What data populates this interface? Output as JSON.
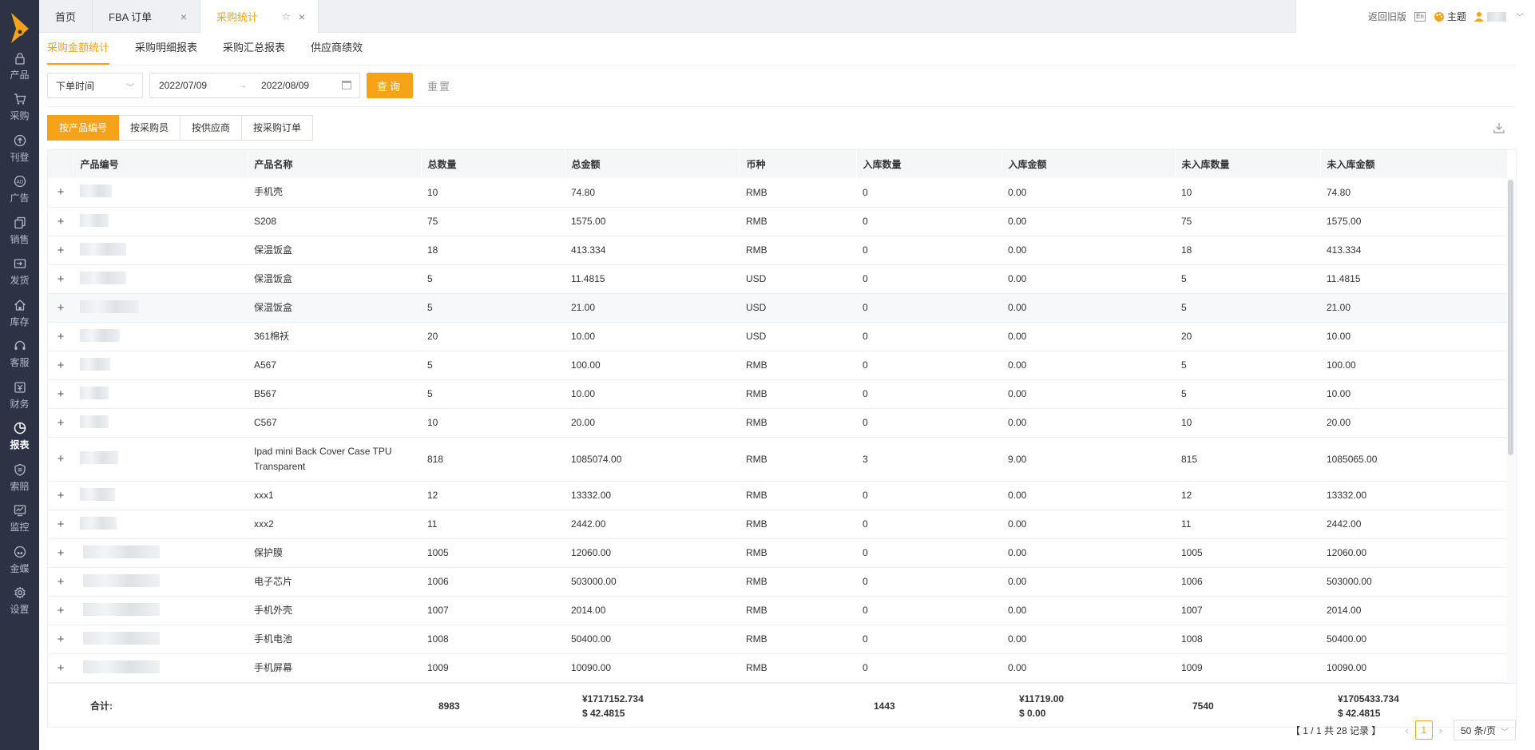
{
  "sidebar": {
    "items": [
      {
        "label": "产品",
        "icon": "lock-icon"
      },
      {
        "label": "采购",
        "icon": "cart-icon"
      },
      {
        "label": "刊登",
        "icon": "upload-icon"
      },
      {
        "label": "广告",
        "icon": "ad-icon"
      },
      {
        "label": "销售",
        "icon": "copy-icon"
      },
      {
        "label": "发货",
        "icon": "truck-icon"
      },
      {
        "label": "库存",
        "icon": "home-icon"
      },
      {
        "label": "客服",
        "icon": "headset-icon"
      },
      {
        "label": "财务",
        "icon": "wallet-icon"
      },
      {
        "label": "报表",
        "icon": "pie-chart-icon"
      },
      {
        "label": "索赔",
        "icon": "shield-icon"
      },
      {
        "label": "监控",
        "icon": "monitor-icon"
      },
      {
        "label": "金蝶",
        "icon": "butterfly-icon"
      },
      {
        "label": "设置",
        "icon": "gear-icon"
      }
    ],
    "active_index": 9
  },
  "tabs": [
    {
      "label": "首页"
    },
    {
      "label": "FBA 订单"
    },
    {
      "label": "采购统计"
    }
  ],
  "tools": {
    "old_version": "返回旧版",
    "lang": "En",
    "theme": "主题"
  },
  "subtabs": [
    "采购金额统计",
    "采购明细报表",
    "采购汇总报表",
    "供应商绩效"
  ],
  "filter": {
    "time_type": "下单时间",
    "start_date": "2022/07/09",
    "end_date": "2022/08/09",
    "query_label": "查询",
    "reset_label": "重置"
  },
  "group_by": [
    "按产品编号",
    "按采购员",
    "按供应商",
    "按采购订单"
  ],
  "table": {
    "columns": [
      "产品编号",
      "产品名称",
      "总数量",
      "总金额",
      "币种",
      "入库数量",
      "入库金额",
      "未入库数量",
      "未入库金额"
    ],
    "rows": [
      {
        "name": "手机壳",
        "qty": "10",
        "amount": "74.80",
        "currency": "RMB",
        "in_qty": "0",
        "in_amount": "0.00",
        "out_qty": "10",
        "out_amount": "74.80"
      },
      {
        "name": "S208",
        "qty": "75",
        "amount": "1575.00",
        "currency": "RMB",
        "in_qty": "0",
        "in_amount": "0.00",
        "out_qty": "75",
        "out_amount": "1575.00"
      },
      {
        "name": "保温饭盒",
        "qty": "18",
        "amount": "413.334",
        "currency": "RMB",
        "in_qty": "0",
        "in_amount": "0.00",
        "out_qty": "18",
        "out_amount": "413.334"
      },
      {
        "name": "保温饭盒",
        "qty": "5",
        "amount": "11.4815",
        "currency": "USD",
        "in_qty": "0",
        "in_amount": "0.00",
        "out_qty": "5",
        "out_amount": "11.4815"
      },
      {
        "name": "保温饭盒",
        "qty": "5",
        "amount": "21.00",
        "currency": "USD",
        "in_qty": "0",
        "in_amount": "0.00",
        "out_qty": "5",
        "out_amount": "21.00"
      },
      {
        "name": "361棉袄",
        "qty": "20",
        "amount": "10.00",
        "currency": "USD",
        "in_qty": "0",
        "in_amount": "0.00",
        "out_qty": "20",
        "out_amount": "10.00"
      },
      {
        "name": "A567",
        "qty": "5",
        "amount": "100.00",
        "currency": "RMB",
        "in_qty": "0",
        "in_amount": "0.00",
        "out_qty": "5",
        "out_amount": "100.00"
      },
      {
        "name": "B567",
        "qty": "5",
        "amount": "10.00",
        "currency": "RMB",
        "in_qty": "0",
        "in_amount": "0.00",
        "out_qty": "5",
        "out_amount": "10.00"
      },
      {
        "name": "C567",
        "qty": "10",
        "amount": "20.00",
        "currency": "RMB",
        "in_qty": "0",
        "in_amount": "0.00",
        "out_qty": "10",
        "out_amount": "20.00"
      },
      {
        "name": "Ipad mini Back Cover Case TPU Transparent",
        "qty": "818",
        "amount": "1085074.00",
        "currency": "RMB",
        "in_qty": "3",
        "in_amount": "9.00",
        "out_qty": "815",
        "out_amount": "1085065.00"
      },
      {
        "name": "xxx1",
        "qty": "12",
        "amount": "13332.00",
        "currency": "RMB",
        "in_qty": "0",
        "in_amount": "0.00",
        "out_qty": "12",
        "out_amount": "13332.00"
      },
      {
        "name": "xxx2",
        "qty": "11",
        "amount": "2442.00",
        "currency": "RMB",
        "in_qty": "0",
        "in_amount": "0.00",
        "out_qty": "11",
        "out_amount": "2442.00"
      },
      {
        "name": "保护膜",
        "qty": "1005",
        "amount": "12060.00",
        "currency": "RMB",
        "in_qty": "0",
        "in_amount": "0.00",
        "out_qty": "1005",
        "out_amount": "12060.00"
      },
      {
        "name": "电子芯片",
        "qty": "1006",
        "amount": "503000.00",
        "currency": "RMB",
        "in_qty": "0",
        "in_amount": "0.00",
        "out_qty": "1006",
        "out_amount": "503000.00"
      },
      {
        "name": "手机外壳",
        "qty": "1007",
        "amount": "2014.00",
        "currency": "RMB",
        "in_qty": "0",
        "in_amount": "0.00",
        "out_qty": "1007",
        "out_amount": "2014.00"
      },
      {
        "name": "手机电池",
        "qty": "1008",
        "amount": "50400.00",
        "currency": "RMB",
        "in_qty": "0",
        "in_amount": "0.00",
        "out_qty": "1008",
        "out_amount": "50400.00"
      },
      {
        "name": "手机屏幕",
        "qty": "1009",
        "amount": "10090.00",
        "currency": "RMB",
        "in_qty": "0",
        "in_amount": "0.00",
        "out_qty": "1009",
        "out_amount": "10090.00"
      }
    ]
  },
  "totals": {
    "label": "合计:",
    "qty": "8983",
    "amount_rmb": "¥1717152.734",
    "amount_usd": "$ 42.4815",
    "in_qty": "1443",
    "in_amount_rmb": "¥11719.00",
    "in_amount_usd": "$ 0.00",
    "out_qty": "7540",
    "out_amount_rmb": "¥1705433.734",
    "out_amount_usd": "$ 42.4815"
  },
  "pager": {
    "info": "【 1 / 1 共 28 记录 】",
    "current": "1",
    "page_size": "50 条/页"
  },
  "colors": {
    "accent": "#f7a31a",
    "sidebar": "#2b3345"
  }
}
